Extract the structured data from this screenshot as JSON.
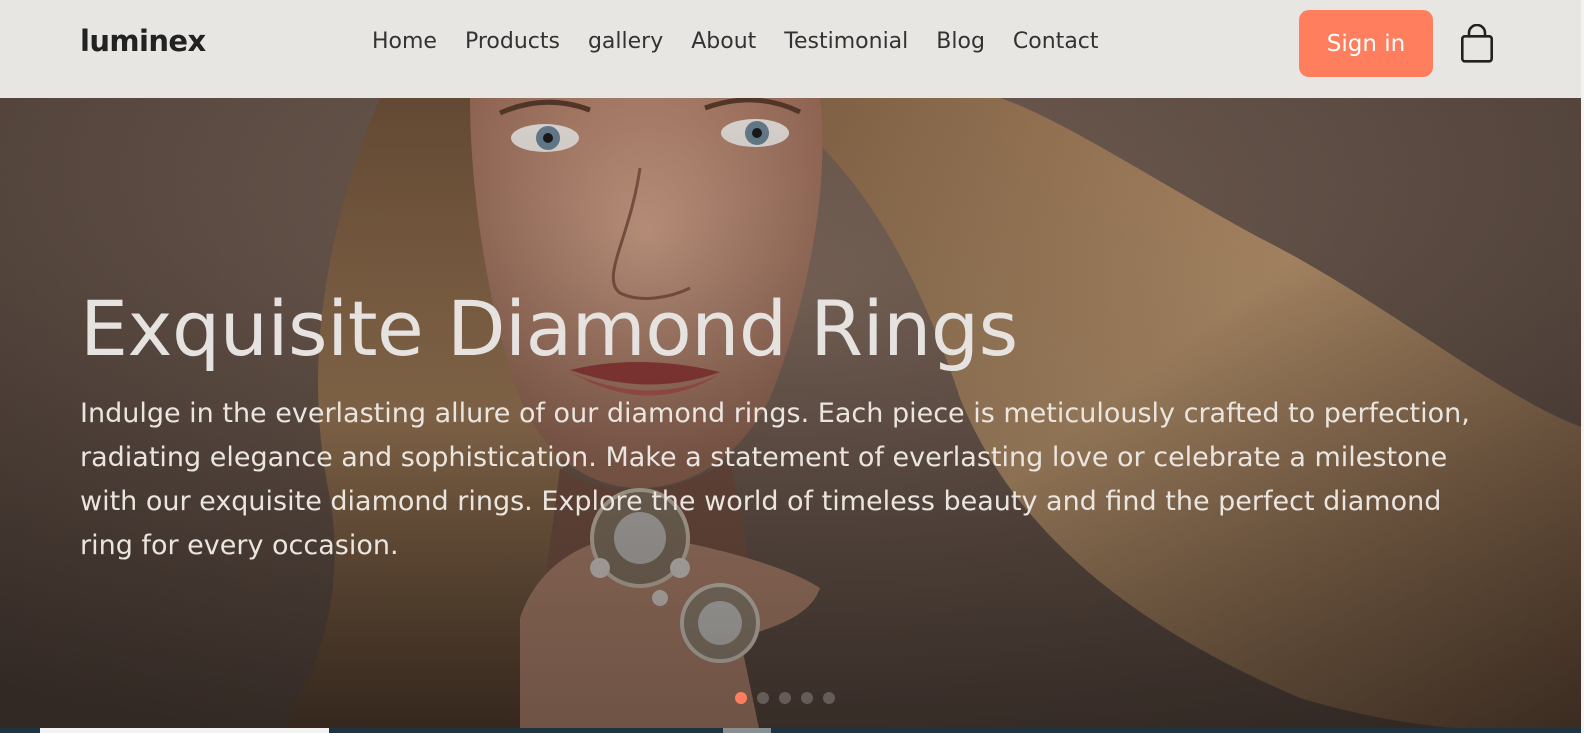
{
  "header": {
    "logo": "luminex",
    "nav": [
      "Home",
      "Products",
      "gallery",
      "About",
      "Testimonial",
      "Blog",
      "Contact"
    ],
    "signin_label": "Sign in",
    "cart_icon": "shopping-bag-icon"
  },
  "hero": {
    "title": "Exquisite Diamond Rings",
    "text": "Indulge in the everlasting allure of our diamond rings. Each piece is meticulously crafted to perfection, radiating elegance and sophistication. Make a statement of everlasting love or celebrate a milestone with our exquisite diamond rings. Explore the world of timeless beauty and find the perfect diamond ring for every occasion.",
    "image": "woman-with-long-wavy-hair-wearing-large-ring",
    "slides_count": 5,
    "active_slide": 1
  },
  "colors": {
    "accent": "#fe7e5d",
    "header_bg": "#e8e6e3",
    "hero_text": "#ebe5e0"
  }
}
